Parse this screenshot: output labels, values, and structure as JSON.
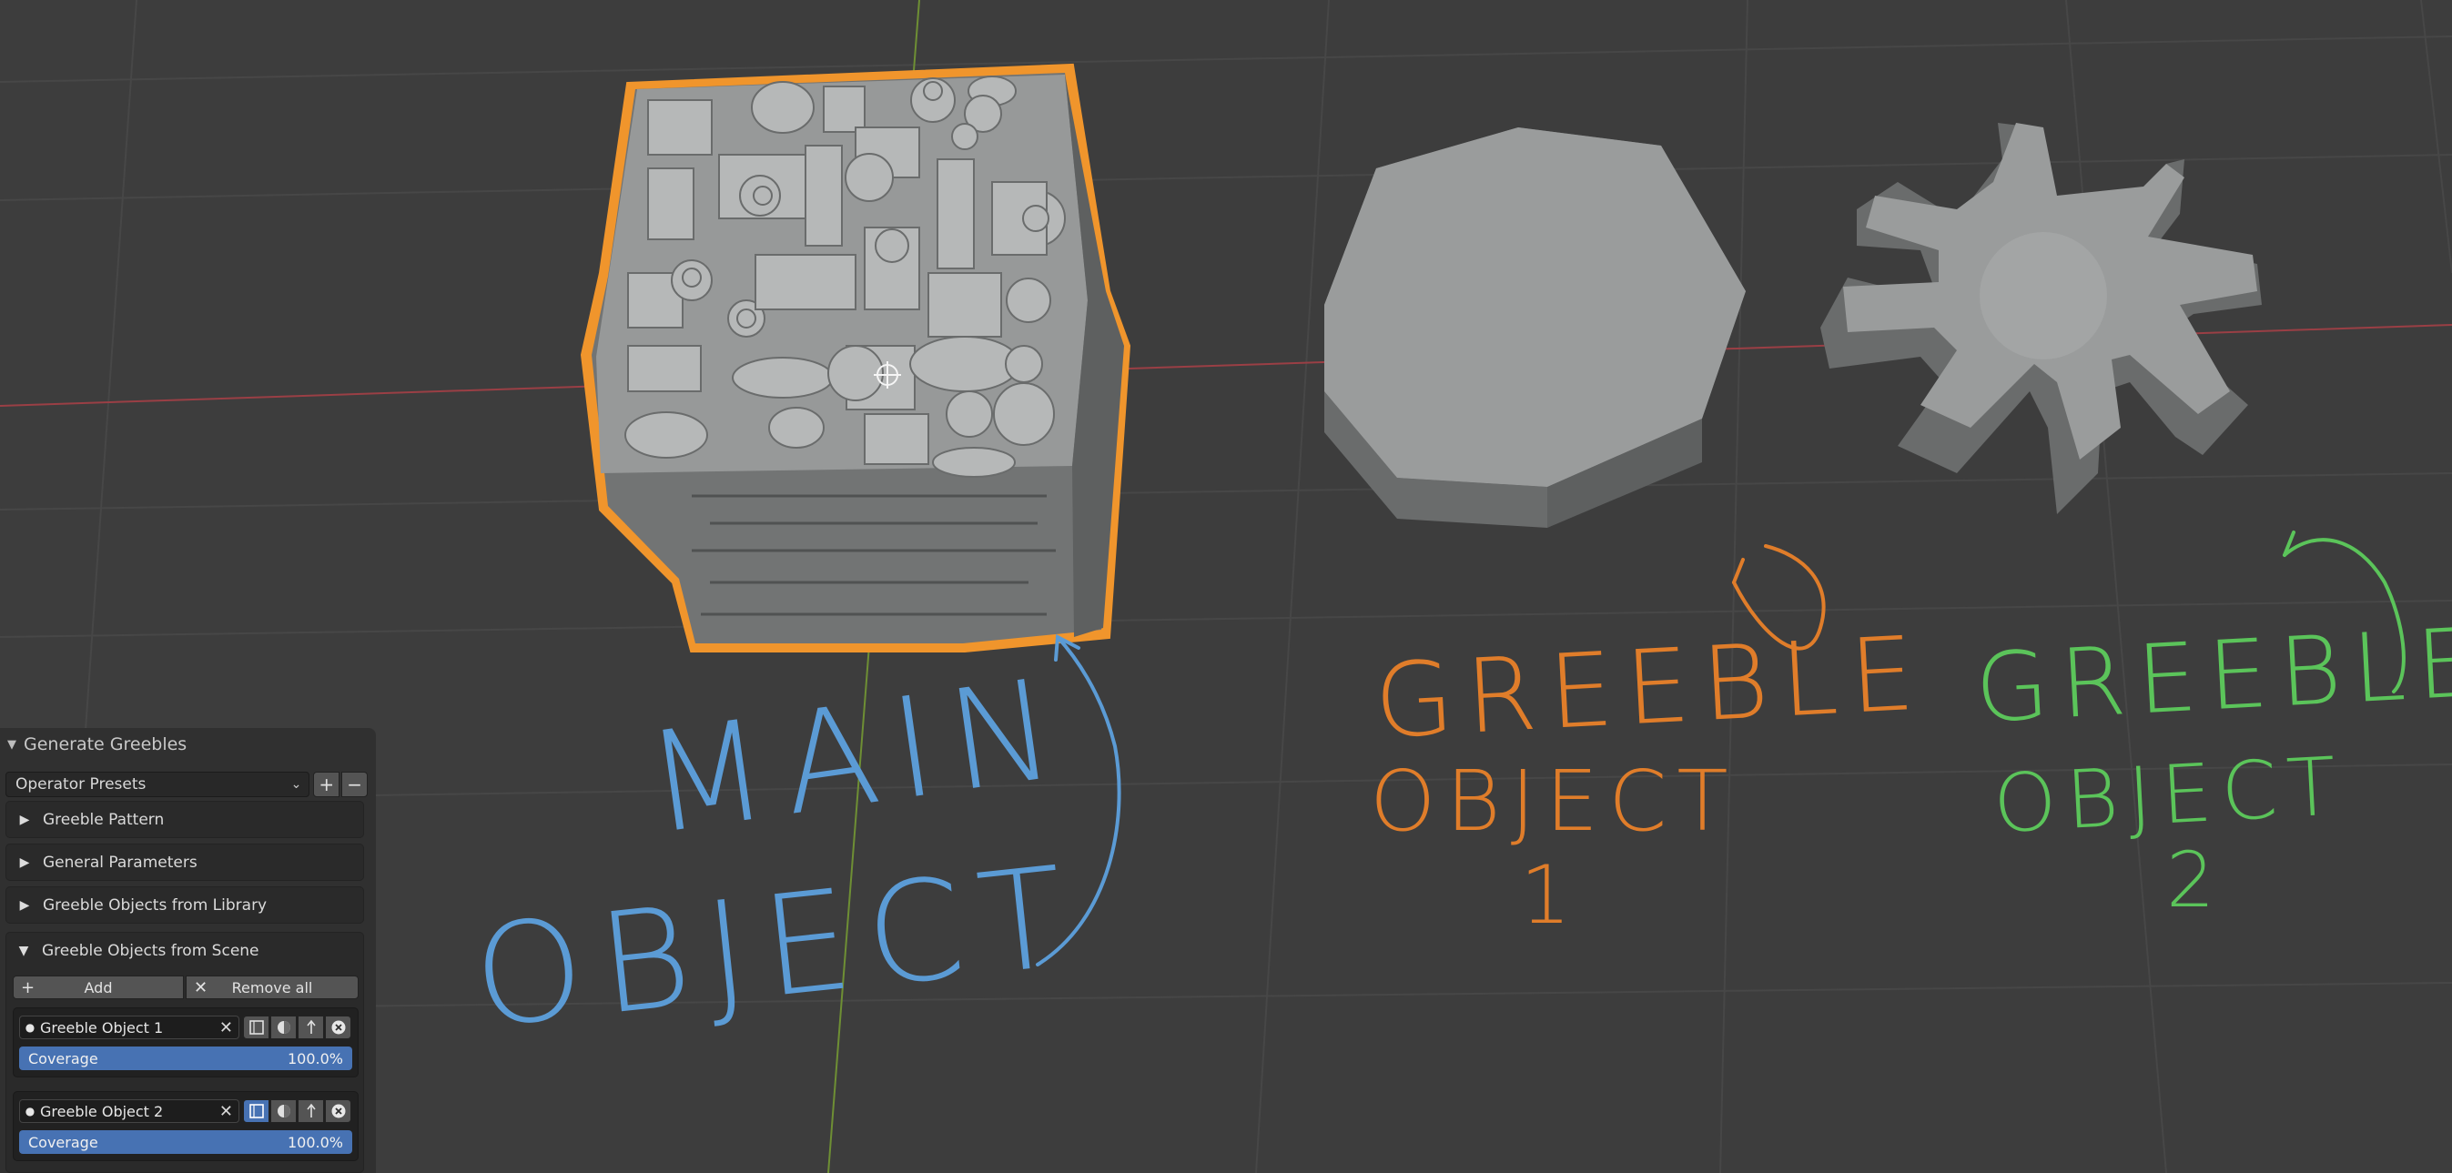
{
  "viewport": {
    "annotations": {
      "main": [
        "MAIN",
        "OBJECT"
      ],
      "greeble1": [
        "GREEBLE",
        "OBJECT",
        "1"
      ],
      "greeble2": [
        "GREEBLE",
        "OBJECT",
        "2"
      ]
    },
    "colors": {
      "background": "#3d3d3d",
      "grid": "#474747",
      "x_axis": "#9a3f45",
      "y_axis": "#6e8f34",
      "object": "#9a9c9c",
      "selection": "#f0952c",
      "main_annotation": "#5b9bd5",
      "greeble1_annotation": "#e07d2a",
      "greeble2_annotation": "#5bc45a"
    }
  },
  "panel": {
    "title": "Generate Greebles",
    "presets": {
      "value": "Operator Presets",
      "add": "+",
      "remove": "−"
    },
    "sections": [
      {
        "label": "Greeble Pattern",
        "expanded": false
      },
      {
        "label": "General Parameters",
        "expanded": false
      },
      {
        "label": "Greeble Objects from Library",
        "expanded": false
      },
      {
        "label": "Greeble Objects from Scene",
        "expanded": true
      }
    ],
    "actions": {
      "add": "Add",
      "remove_all": "Remove all"
    },
    "objects": [
      {
        "name": "Greeble Object 1",
        "coverage_label": "Coverage",
        "coverage": "100.0%",
        "icons": [
          "square-icon",
          "sphere-icon",
          "arrow-up-icon",
          "close-circle-icon"
        ]
      },
      {
        "name": "Greeble Object 2",
        "coverage_label": "Coverage",
        "coverage": "100.0%",
        "icons": [
          "square-icon",
          "sphere-icon",
          "arrow-up-icon",
          "close-circle-icon"
        ]
      }
    ]
  }
}
